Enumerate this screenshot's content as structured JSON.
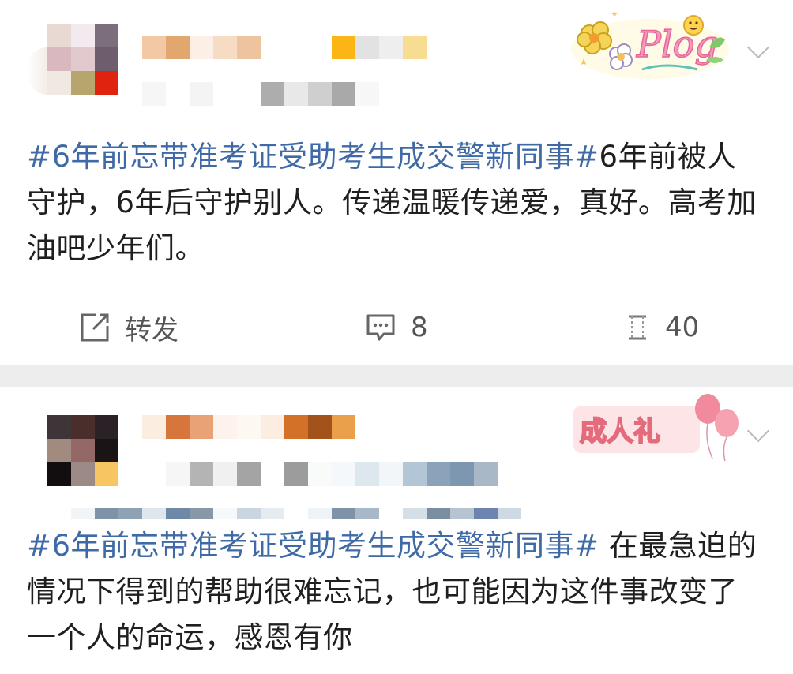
{
  "feed": {
    "posts": [
      {
        "sticker_icon": "plog-sticker-icon",
        "hashtag": "#6年前忘带准考证受助考生成交警新同事#",
        "text": "6年前被人守护，6年后守护别人。传递温暖传递爱，真好。高考加油吧少年们。",
        "actions": {
          "repost_icon": "share-icon",
          "repost_label": "转发",
          "comment_icon": "comment-icon",
          "comment_count": "8",
          "like_icon": "like-icon",
          "like_count": "40"
        }
      },
      {
        "sticker_text": "成人礼",
        "hashtag": "#6年前忘带准考证受助考生成交警新同事#",
        "text": " 在最急迫的情况下得到的帮助很难忘记，也可能因为这件事改变了一个人的命运，感恩有你"
      }
    ]
  },
  "colors": {
    "hashtag": "#3f6aa6",
    "separator": "#ededed",
    "action_text": "#555555"
  }
}
